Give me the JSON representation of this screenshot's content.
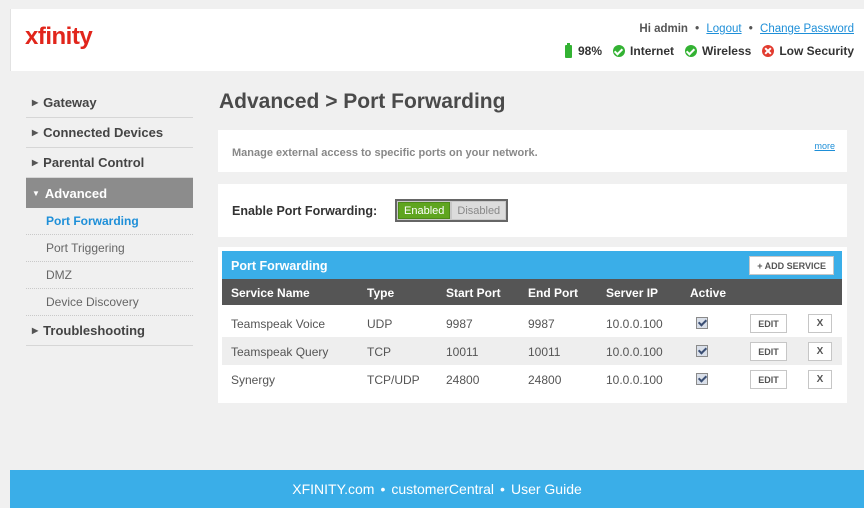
{
  "header": {
    "logo": "xfinity",
    "greeting": "Hi admin",
    "logout": "Logout",
    "change_password": "Change Password",
    "separator": "•",
    "battery": "98%",
    "internet": "Internet",
    "wireless": "Wireless",
    "security": "Low Security",
    "colors": {
      "brand": "#e1251b",
      "ok": "#33b233",
      "warning": "#e23b2f"
    }
  },
  "sidebar": {
    "gateway": "Gateway",
    "connected_devices": "Connected Devices",
    "parental_control": "Parental Control",
    "advanced": "Advanced",
    "sub": [
      "Port Forwarding",
      "Port Triggering",
      "DMZ",
      "Device Discovery"
    ],
    "troubleshooting": "Troubleshooting"
  },
  "main": {
    "title": "Advanced > Port Forwarding",
    "description": "Manage external access to specific ports on your network.",
    "more": "more",
    "enable_label": "Enable Port Forwarding:",
    "enabled": "Enabled",
    "disabled": "Disabled",
    "table": {
      "title": "Port Forwarding",
      "add_button": "+ ADD SERVICE",
      "columns": [
        "Service Name",
        "Type",
        "Start Port",
        "End Port",
        "Server IP",
        "Active"
      ],
      "rows": [
        {
          "service": "Teamspeak Voice",
          "type": "UDP",
          "start": "9987",
          "end": "9987",
          "ip": "10.0.0.100",
          "active": true
        },
        {
          "service": "Teamspeak Query",
          "type": "TCP",
          "start": "10011",
          "end": "10011",
          "ip": "10.0.0.100",
          "active": true
        },
        {
          "service": "Synergy",
          "type": "TCP/UDP",
          "start": "24800",
          "end": "24800",
          "ip": "10.0.0.100",
          "active": true
        }
      ],
      "edit": "EDIT",
      "delete": "X"
    }
  },
  "footer": {
    "link1": "XFINITY.com",
    "link2": "customerCentral",
    "link3": "User Guide",
    "dot": "•"
  }
}
